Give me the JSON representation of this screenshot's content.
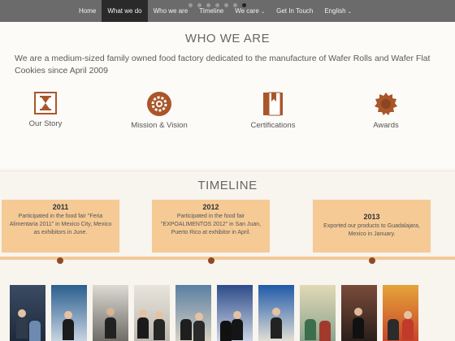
{
  "nav": {
    "items": [
      {
        "label": "Home",
        "active": false
      },
      {
        "label": "What we do",
        "active": true
      },
      {
        "label": "Who we are",
        "active": false
      },
      {
        "label": "Timeline",
        "active": false
      },
      {
        "label": "We care",
        "active": false,
        "dropdown": true
      },
      {
        "label": "Get In Touch",
        "active": false
      },
      {
        "label": "English",
        "active": false,
        "dropdown": true
      }
    ],
    "slide_dots": 7,
    "active_dot": 6
  },
  "who": {
    "title": "WHO WE ARE",
    "text": "We are a medium-sized family owned food factory dedicated to the manufacture of Wafer Rolls and Wafer Flat Cookies since April 2009",
    "features": [
      {
        "label": "Our Story",
        "icon": "hourglass-icon"
      },
      {
        "label": "Mission & Vision",
        "icon": "gear-icon"
      },
      {
        "label": "Certifications",
        "icon": "certificate-icon"
      },
      {
        "label": "Awards",
        "icon": "award-seal-icon"
      }
    ]
  },
  "timeline": {
    "title": "TIMELINE",
    "events": [
      {
        "year": "2011",
        "text": "Participated in the food fair \"Feria Alimentaria 2011\" in Mexico City, Mexico as exhibitors in June."
      },
      {
        "year": "2012",
        "text": "Participated in the food fair \"EXPOALIMENTOS 2012\" in San Juan, Puerto Rico at exhibitor in April."
      },
      {
        "year": "2013",
        "text": "Exported our products to Guadalajara, Mexico in January."
      }
    ]
  },
  "colors": {
    "accent": "#a9562b",
    "card": "#f5ca95",
    "nav_bg": "#6b6b6b",
    "nav_active": "#2a2a2a"
  }
}
